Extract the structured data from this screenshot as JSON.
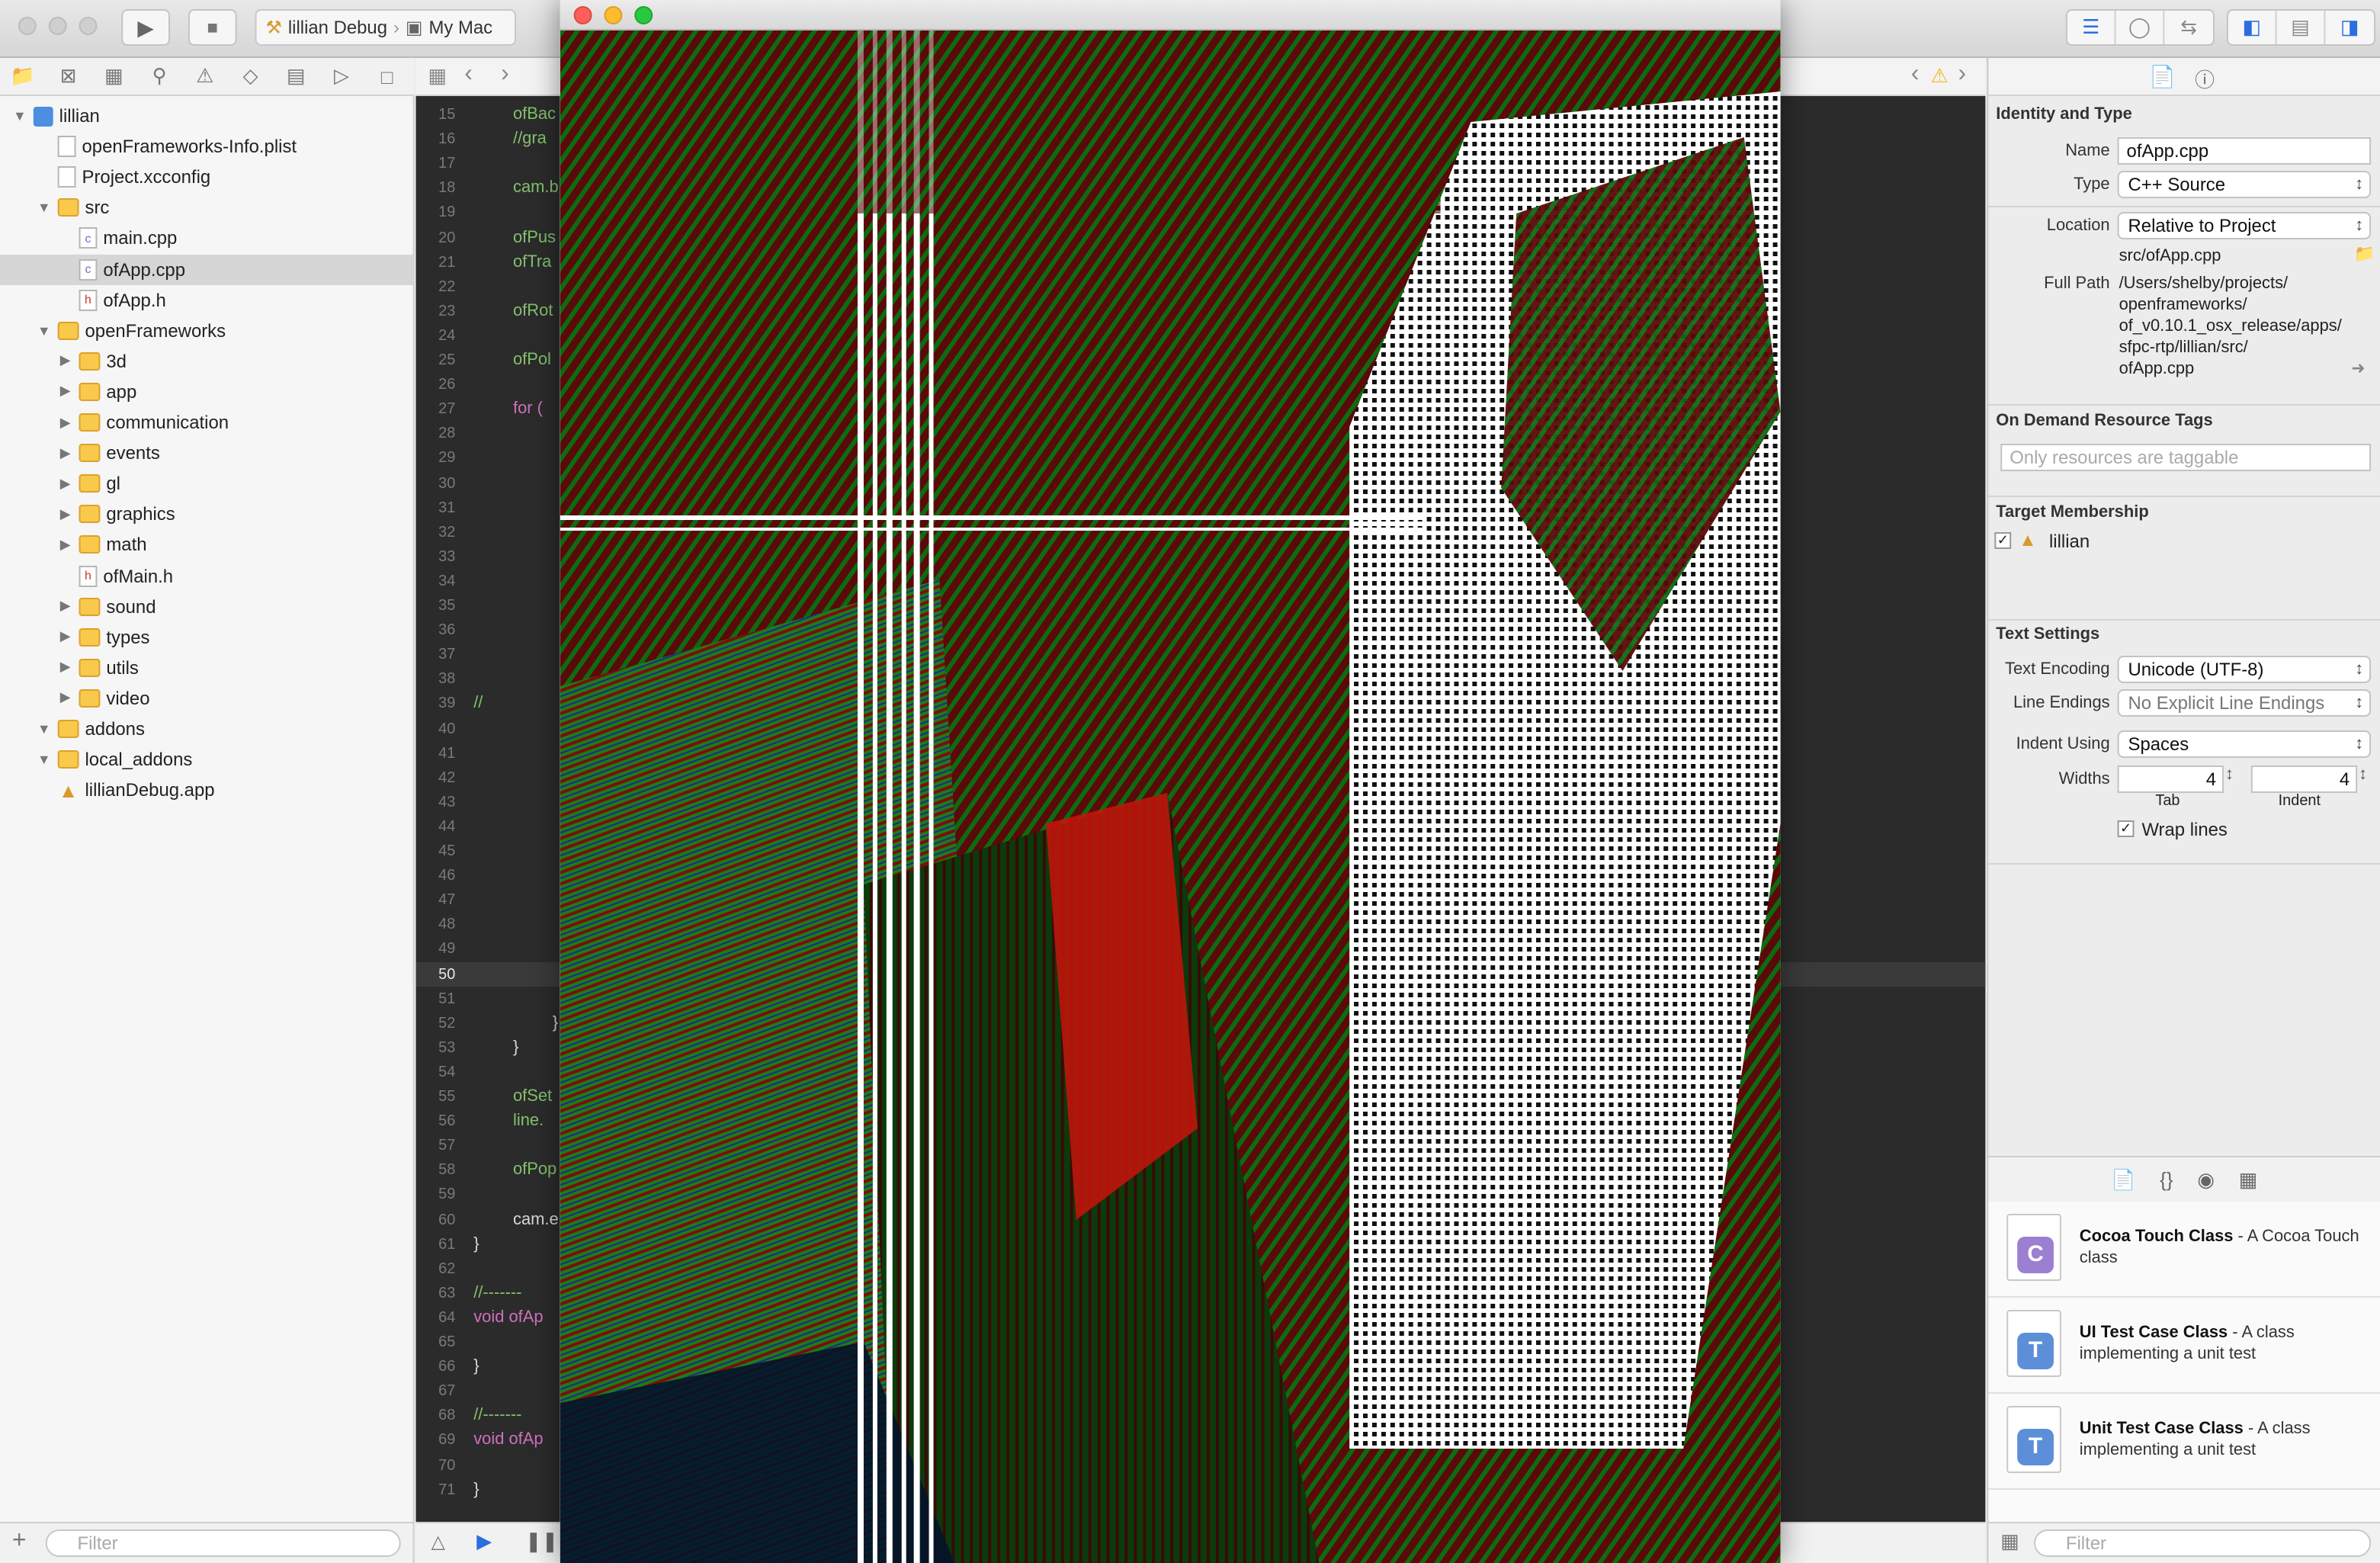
{
  "toolbar": {
    "scheme_target": "lillian Debug",
    "scheme_device": "My Mac",
    "run_icon": "play-icon",
    "stop_icon": "stop-icon"
  },
  "navigator": {
    "filter_placeholder": "Filter",
    "items": [
      {
        "label": "lillian",
        "kind": "project",
        "depth": 0,
        "disclosure": "open"
      },
      {
        "label": "openFrameworks-Info.plist",
        "kind": "file",
        "depth": 1,
        "disclosure": ""
      },
      {
        "label": "Project.xcconfig",
        "kind": "file",
        "depth": 1,
        "disclosure": ""
      },
      {
        "label": "src",
        "kind": "folder",
        "depth": 1,
        "disclosure": "open"
      },
      {
        "label": "main.cpp",
        "kind": "cpp",
        "depth": 2,
        "disclosure": ""
      },
      {
        "label": "ofApp.cpp",
        "kind": "cpp",
        "depth": 2,
        "disclosure": "",
        "selected": true
      },
      {
        "label": "ofApp.h",
        "kind": "h",
        "depth": 2,
        "disclosure": ""
      },
      {
        "label": "openFrameworks",
        "kind": "folder",
        "depth": 1,
        "disclosure": "open"
      },
      {
        "label": "3d",
        "kind": "folder",
        "depth": 2,
        "disclosure": "closed"
      },
      {
        "label": "app",
        "kind": "folder",
        "depth": 2,
        "disclosure": "closed"
      },
      {
        "label": "communication",
        "kind": "folder",
        "depth": 2,
        "disclosure": "closed"
      },
      {
        "label": "events",
        "kind": "folder",
        "depth": 2,
        "disclosure": "closed"
      },
      {
        "label": "gl",
        "kind": "folder",
        "depth": 2,
        "disclosure": "closed"
      },
      {
        "label": "graphics",
        "kind": "folder",
        "depth": 2,
        "disclosure": "closed"
      },
      {
        "label": "math",
        "kind": "folder",
        "depth": 2,
        "disclosure": "closed"
      },
      {
        "label": "ofMain.h",
        "kind": "h",
        "depth": 2,
        "disclosure": ""
      },
      {
        "label": "sound",
        "kind": "folder",
        "depth": 2,
        "disclosure": "closed"
      },
      {
        "label": "types",
        "kind": "folder",
        "depth": 2,
        "disclosure": "closed"
      },
      {
        "label": "utils",
        "kind": "folder",
        "depth": 2,
        "disclosure": "closed"
      },
      {
        "label": "video",
        "kind": "folder",
        "depth": 2,
        "disclosure": "closed"
      },
      {
        "label": "addons",
        "kind": "folder",
        "depth": 1,
        "disclosure": "open"
      },
      {
        "label": "local_addons",
        "kind": "folder",
        "depth": 1,
        "disclosure": "open"
      },
      {
        "label": "lillianDebug.app",
        "kind": "app",
        "depth": 1,
        "disclosure": ""
      }
    ]
  },
  "editor": {
    "current_line": "50",
    "lines": [
      {
        "n": "15",
        "text": "ofBac",
        "cls": "g",
        "indent": 1
      },
      {
        "n": "16",
        "text": "//gra",
        "cls": "g",
        "indent": 1
      },
      {
        "n": "17",
        "text": "",
        "cls": "",
        "indent": 1
      },
      {
        "n": "18",
        "text": "cam.b",
        "cls": "g",
        "indent": 1
      },
      {
        "n": "19",
        "text": "",
        "cls": "",
        "indent": 1
      },
      {
        "n": "20",
        "text": "ofPus",
        "cls": "g",
        "indent": 1
      },
      {
        "n": "21",
        "text": "ofTra",
        "cls": "g",
        "indent": 1
      },
      {
        "n": "22",
        "text": "",
        "cls": "",
        "indent": 1
      },
      {
        "n": "23",
        "text": "ofRot",
        "cls": "g",
        "indent": 1
      },
      {
        "n": "24",
        "text": "",
        "cls": "",
        "indent": 1
      },
      {
        "n": "25",
        "text": "ofPol",
        "cls": "g",
        "indent": 1
      },
      {
        "n": "26",
        "text": "",
        "cls": "",
        "indent": 1
      },
      {
        "n": "27",
        "text": "for (",
        "cls": "k",
        "indent": 1
      },
      {
        "n": "28",
        "text": "",
        "cls": "",
        "indent": 1
      },
      {
        "n": "29",
        "text": "",
        "cls": "",
        "indent": 1
      },
      {
        "n": "30",
        "text": "",
        "cls": "",
        "indent": 1
      },
      {
        "n": "31",
        "text": "",
        "cls": "",
        "indent": 1
      },
      {
        "n": "32",
        "text": "",
        "cls": "",
        "indent": 1
      },
      {
        "n": "33",
        "text": "",
        "cls": "",
        "indent": 1
      },
      {
        "n": "34",
        "text": "",
        "cls": "",
        "indent": 1
      },
      {
        "n": "35",
        "text": "",
        "cls": "",
        "indent": 1
      },
      {
        "n": "36",
        "text": "",
        "cls": "",
        "indent": 1
      },
      {
        "n": "37",
        "text": "",
        "cls": "",
        "indent": 1
      },
      {
        "n": "38",
        "text": "",
        "cls": "",
        "indent": 1
      },
      {
        "n": "39",
        "text": "//",
        "cls": "g",
        "indent": 0
      },
      {
        "n": "40",
        "text": "",
        "cls": "",
        "indent": 0
      },
      {
        "n": "41",
        "text": "",
        "cls": "",
        "indent": 0
      },
      {
        "n": "42",
        "text": "",
        "cls": "",
        "indent": 0
      },
      {
        "n": "43",
        "text": "",
        "cls": "",
        "indent": 0
      },
      {
        "n": "44",
        "text": "",
        "cls": "",
        "indent": 0
      },
      {
        "n": "45",
        "text": "",
        "cls": "",
        "indent": 0
      },
      {
        "n": "46",
        "text": "",
        "cls": "",
        "indent": 0
      },
      {
        "n": "47",
        "text": "",
        "cls": "",
        "indent": 0
      },
      {
        "n": "48",
        "text": "",
        "cls": "",
        "indent": 0
      },
      {
        "n": "49",
        "text": "",
        "cls": "",
        "indent": 0
      },
      {
        "n": "50",
        "text": "",
        "cls": "",
        "indent": 0
      },
      {
        "n": "51",
        "text": "",
        "cls": "",
        "indent": 0
      },
      {
        "n": "52",
        "text": "}",
        "cls": "",
        "indent": 2
      },
      {
        "n": "53",
        "text": "}",
        "cls": "",
        "indent": 1
      },
      {
        "n": "54",
        "text": "",
        "cls": "",
        "indent": 1
      },
      {
        "n": "55",
        "text": "ofSet",
        "cls": "g",
        "indent": 1
      },
      {
        "n": "56",
        "text": "line.",
        "cls": "g",
        "indent": 1
      },
      {
        "n": "57",
        "text": "",
        "cls": "",
        "indent": 1
      },
      {
        "n": "58",
        "text": "ofPop",
        "cls": "g",
        "indent": 1
      },
      {
        "n": "59",
        "text": "",
        "cls": "",
        "indent": 1
      },
      {
        "n": "60",
        "text": "cam.e",
        "cls": "",
        "indent": 1
      },
      {
        "n": "61",
        "text": "}",
        "cls": "",
        "indent": 0
      },
      {
        "n": "62",
        "text": "",
        "cls": "",
        "indent": 0
      },
      {
        "n": "63",
        "text": "//-------",
        "cls": "g",
        "indent": 0
      },
      {
        "n": "64",
        "text": "void ofAp",
        "cls": "k",
        "indent": 0
      },
      {
        "n": "65",
        "text": "",
        "cls": "",
        "indent": 0
      },
      {
        "n": "66",
        "text": "}",
        "cls": "",
        "indent": 0
      },
      {
        "n": "67",
        "text": "",
        "cls": "",
        "indent": 0
      },
      {
        "n": "68",
        "text": "//-------",
        "cls": "g",
        "indent": 0
      },
      {
        "n": "69",
        "text": "void ofAp",
        "cls": "k",
        "indent": 0
      },
      {
        "n": "70",
        "text": "",
        "cls": "",
        "indent": 0
      },
      {
        "n": "71",
        "text": "}",
        "cls": "",
        "indent": 0
      }
    ]
  },
  "inspector": {
    "identity_title": "Identity and Type",
    "name_label": "Name",
    "name_value": "ofApp.cpp",
    "type_label": "Type",
    "type_value": "C++ Source",
    "location_label": "Location",
    "location_value": "Relative to Project",
    "location_path": "src/ofApp.cpp",
    "fullpath_label": "Full Path",
    "fullpath_lines": [
      "/Users/shelby/projects/",
      "openframeworks/",
      "of_v0.10.1_osx_release/apps/",
      "sfpc-rtp/lillian/src/",
      "ofApp.cpp"
    ],
    "ondemand_title": "On Demand Resource Tags",
    "ondemand_placeholder": "Only resources are taggable",
    "membership_title": "Target Membership",
    "membership_target": "lillian",
    "text_settings_title": "Text Settings",
    "encoding_label": "Text Encoding",
    "encoding_value": "Unicode (UTF-8)",
    "line_endings_label": "Line Endings",
    "line_endings_value": "No Explicit Line Endings",
    "indent_using_label": "Indent Using",
    "indent_using_value": "Spaces",
    "widths_label": "Widths",
    "tab_value": "4",
    "indent_value": "4",
    "tab_caption": "Tab",
    "indent_caption": "Indent",
    "wrap_lines_label": "Wrap lines"
  },
  "library": {
    "filter_placeholder": "Filter",
    "items": [
      {
        "title": "Cocoa Touch Class",
        "desc": "A Cocoa Touch class",
        "glyph": "C",
        "color": "#9b7fd0"
      },
      {
        "title": "UI Test Case Class",
        "desc": "A class implementing a unit test",
        "glyph": "T",
        "color": "#5d8fd8"
      },
      {
        "title": "Unit Test Case Class",
        "desc": "A class implementing a unit test",
        "glyph": "T",
        "color": "#5d8fd8"
      }
    ]
  },
  "colors": {
    "accent": "#2a6ee0",
    "editor_bg": "#2b2b2b",
    "warning": "#f2b824"
  }
}
